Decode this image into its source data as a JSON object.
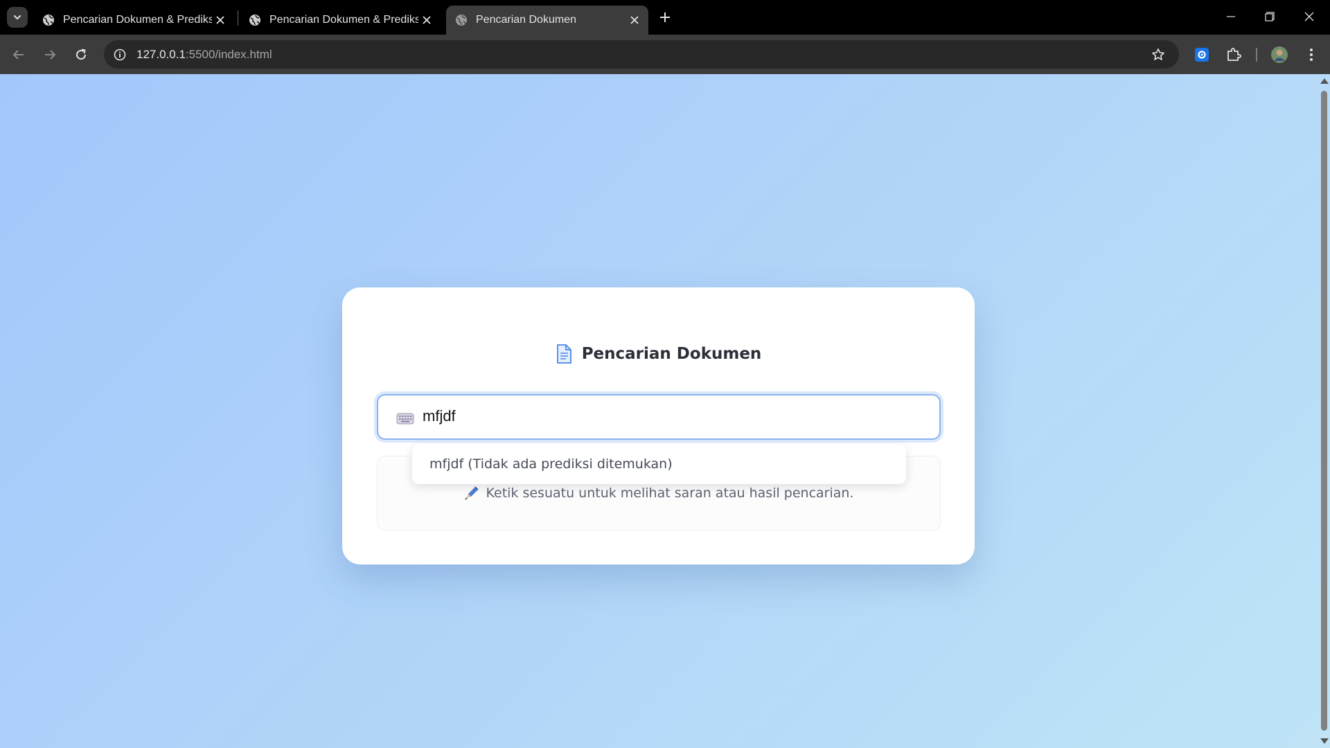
{
  "browser": {
    "tabs": [
      {
        "title": "Pencarian Dokumen & Prediksi",
        "active": false
      },
      {
        "title": "Pencarian Dokumen & Prediksi",
        "active": false
      },
      {
        "title": "Pencarian Dokumen",
        "active": true
      }
    ],
    "url_host": "127.0.0.1",
    "url_path": ":5500/index.html"
  },
  "page": {
    "title": "Pencarian Dokumen",
    "title_icon": "document-icon",
    "search": {
      "icon": "keyboard-icon",
      "value": "mfjdf"
    },
    "suggestions": [
      {
        "label": "mfjdf (Tidak ada prediksi ditemukan)"
      }
    ],
    "results": {
      "icon": "pen-icon",
      "hint": "Ketik sesuatu untuk melihat saran atau hasil pencarian."
    }
  },
  "colors": {
    "background_start": "#a3c7fb",
    "background_end": "#c0e4f6",
    "card": "#ffffff",
    "input_border": "#8ab3ef",
    "title_text": "#2b2f38",
    "hint_text": "#5c6370",
    "icon_blue": "#4a86e8"
  }
}
